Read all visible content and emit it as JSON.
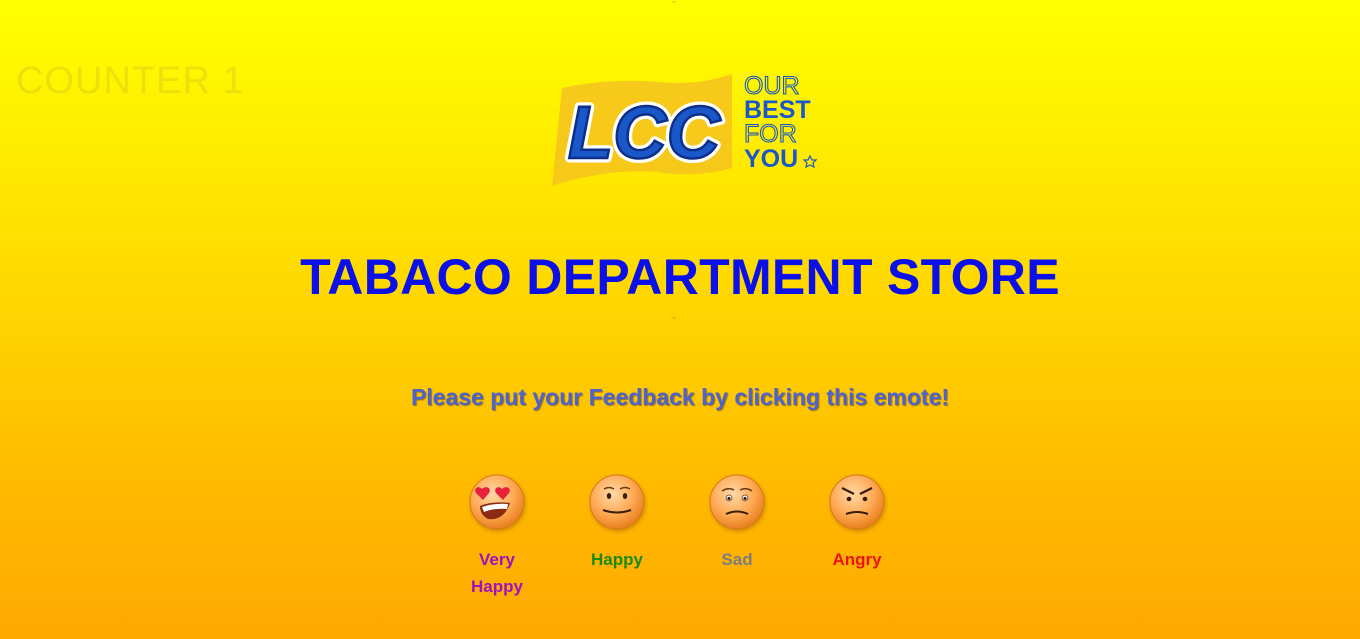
{
  "counter": {
    "label": "COUNTER 1"
  },
  "logo": {
    "brand": "LCC",
    "tagline": [
      "OUR",
      "BEST",
      "FOR",
      "YOU"
    ]
  },
  "store": {
    "title": "TABACO DEPARTMENT STORE"
  },
  "feedback": {
    "prompt": "Please put your Feedback by clicking this emote!",
    "emotes": [
      {
        "label": "Very Happy",
        "icon": "heart-eyes-emoji-icon",
        "color": "#a010c0"
      },
      {
        "label": "Happy",
        "icon": "smiling-emoji-icon",
        "color": "#1a8a10"
      },
      {
        "label": "Sad",
        "icon": "sad-emoji-icon",
        "color": "#7d7d7d"
      },
      {
        "label": "Angry",
        "icon": "angry-emoji-icon",
        "color": "#ee1111"
      }
    ]
  },
  "colors": {
    "background_top": "#ffff00",
    "background_bottom": "#ffa800",
    "title": "#0b10e8",
    "prompt": "#4d63d2",
    "logo_blue": "#1a57c8"
  }
}
